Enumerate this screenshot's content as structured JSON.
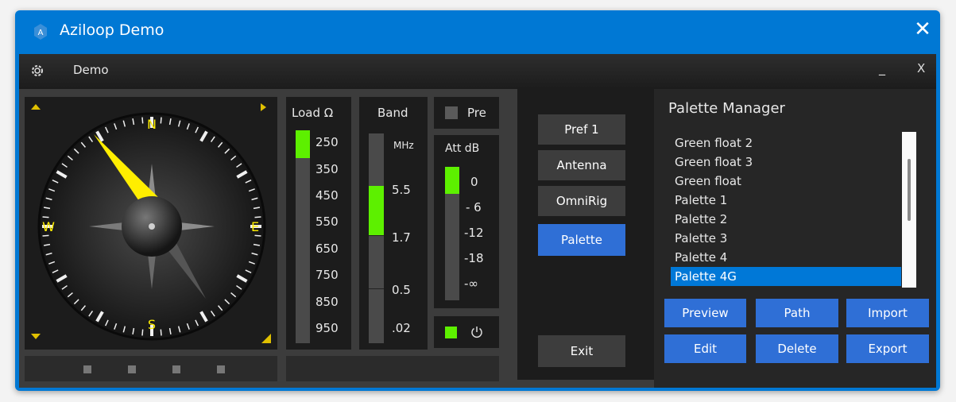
{
  "window": {
    "title": "Aziloop Demo",
    "close_glyph": "✕"
  },
  "appbar": {
    "title": "Demo",
    "minimize_glyph": "_",
    "close_glyph": "X",
    "settings_icon": "gear-icon"
  },
  "compass": {
    "heading_deg": 330,
    "labels": {
      "n": "N",
      "s": "S",
      "e": "E",
      "w": "W"
    },
    "status_leds": 4
  },
  "load": {
    "header": "Load Ω",
    "values": [
      "250",
      "350",
      "450",
      "550",
      "650",
      "750",
      "850",
      "950"
    ],
    "level_fraction": 0.13
  },
  "band": {
    "header": "Band",
    "unit": "MHz",
    "values": [
      "5.5",
      "1.7",
      "0.5",
      ".02"
    ],
    "selected": "1.7"
  },
  "pre": {
    "label": "Pre",
    "checked": false
  },
  "att": {
    "header": "Att dB",
    "values": [
      "0",
      "- 6",
      "-12",
      "-18",
      "-∞"
    ],
    "level_fraction": 0.2
  },
  "power": {
    "on": true,
    "icon": "power-icon"
  },
  "menu": {
    "buttons": [
      "Pref 1",
      "Antenna",
      "OmniRig",
      "Palette"
    ],
    "active": "Palette",
    "exit": "Exit"
  },
  "palette_manager": {
    "title": "Palette Manager",
    "items": [
      "Green float 2",
      "Green float 3",
      "Green float",
      "Palette 1",
      "Palette 2",
      "Palette 3",
      "Palette 4",
      "Palette 4G"
    ],
    "selected": "Palette 4G",
    "actions": [
      "Preview",
      "Path",
      "Import",
      "Edit",
      "Delete",
      "Export"
    ]
  },
  "colors": {
    "accent": "#0078d4",
    "button_blue": "#2f6fd6",
    "level_green": "#5df000",
    "needle_yellow": "#ffee00"
  }
}
